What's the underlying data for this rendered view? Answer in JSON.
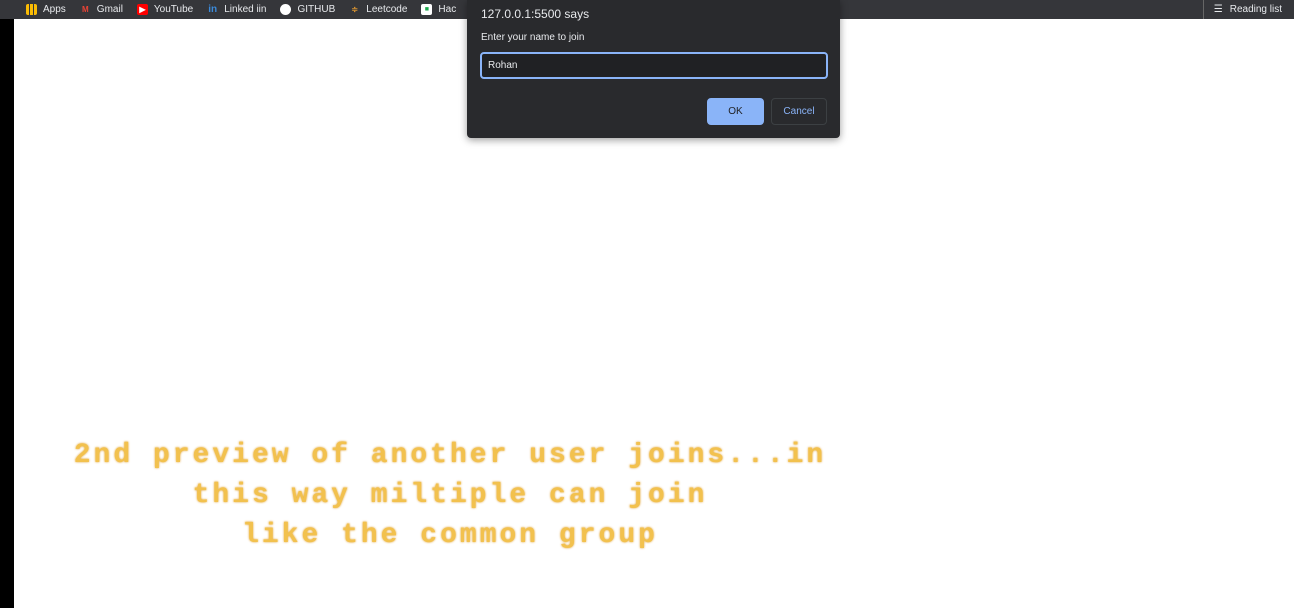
{
  "bookmarks": [
    {
      "label": "Apps",
      "icon": "apps-grid-icon"
    },
    {
      "label": "Gmail",
      "icon": "gmail-icon"
    },
    {
      "label": "YouTube",
      "icon": "youtube-icon"
    },
    {
      "label": "Linked iin",
      "icon": "linkedin-icon"
    },
    {
      "label": "GITHUB",
      "icon": "github-icon"
    },
    {
      "label": "Leetcode",
      "icon": "leetcode-icon"
    },
    {
      "label": "Hac",
      "icon": "hackerrank-icon"
    }
  ],
  "reading_list": "Reading list",
  "dialog": {
    "title": "127.0.0.1:5500 says",
    "message": "Enter your name to join",
    "value": "Rohan",
    "ok": "OK",
    "cancel": "Cancel"
  },
  "caption": [
    "2nd preview of another user joins...in",
    "this way miltiple can join",
    "like the common group"
  ]
}
